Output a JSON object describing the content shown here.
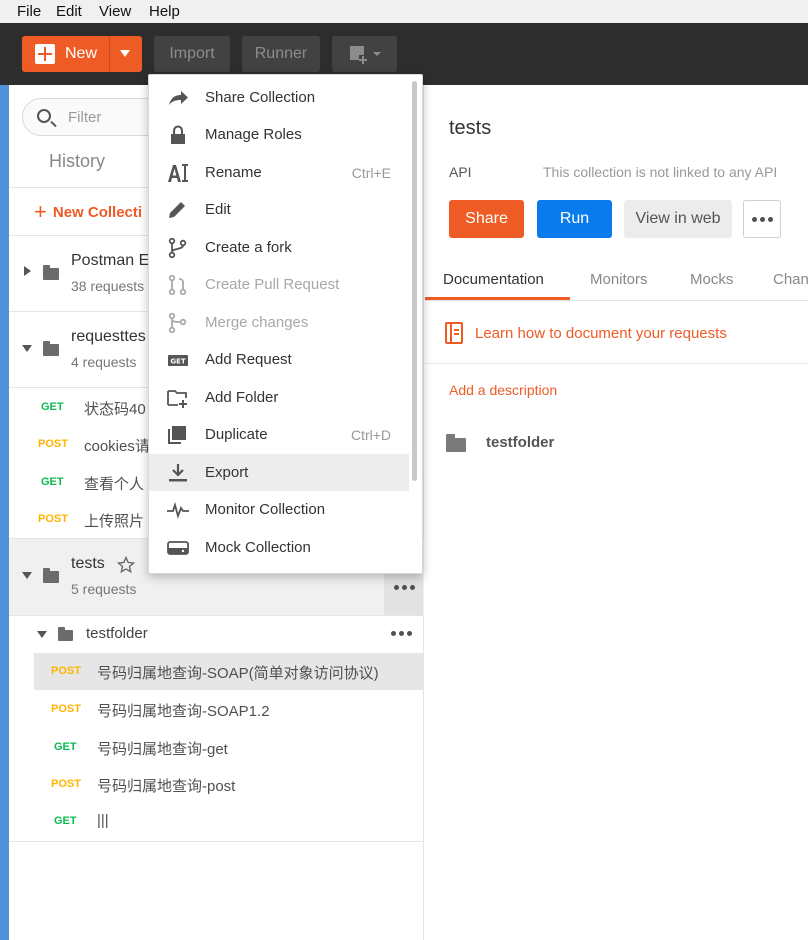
{
  "menubar": {
    "items": [
      "File",
      "Edit",
      "View",
      "Help"
    ]
  },
  "toolbar": {
    "new_label": "New",
    "import_label": "Import",
    "runner_label": "Runner"
  },
  "sidebar": {
    "search_placeholder": "Filter",
    "history_tab": "History",
    "new_collection": "New Collecti",
    "collections": [
      {
        "name": "Postman E",
        "count": "38 requests"
      },
      {
        "name": "requesttes",
        "count": "4 requests",
        "requests": [
          {
            "method": "GET",
            "name": "状态码40"
          },
          {
            "method": "POST",
            "name": "cookies请"
          },
          {
            "method": "GET",
            "name": "查看个人"
          },
          {
            "method": "POST",
            "name": "上传照片"
          }
        ]
      },
      {
        "name": "tests",
        "count": "5 requests",
        "folder": "testfolder",
        "requests": [
          {
            "method": "POST",
            "name": "号码归属地查询-SOAP(简单对象访问协议)"
          },
          {
            "method": "POST",
            "name": "号码归属地查询-SOAP1.2"
          },
          {
            "method": "GET",
            "name": "号码归属地查询-get"
          },
          {
            "method": "POST",
            "name": "号码归属地查询-post"
          },
          {
            "method": "GET",
            "name": "|||"
          }
        ]
      }
    ]
  },
  "main": {
    "title": "tests",
    "api_label": "API",
    "api_note": "This collection is not linked to any API",
    "share": "Share",
    "run": "Run",
    "view_in_web": "View in web",
    "tabs": [
      "Documentation",
      "Monitors",
      "Mocks",
      "Chan"
    ],
    "learn_link": "Learn how to document your requests",
    "add_description": "Add a description",
    "folder_name": "testfolder"
  },
  "dropdown": {
    "items": [
      {
        "label": "Share Collection",
        "shortcut": "",
        "icon": "share-arrow-icon"
      },
      {
        "label": "Manage Roles",
        "shortcut": "",
        "icon": "lock-icon"
      },
      {
        "label": "Rename",
        "shortcut": "Ctrl+E",
        "icon": "rename-cursor-icon"
      },
      {
        "label": "Edit",
        "shortcut": "",
        "icon": "pencil-icon"
      },
      {
        "label": "Create a fork",
        "shortcut": "",
        "icon": "fork-icon"
      },
      {
        "label": "Create Pull Request",
        "shortcut": "",
        "icon": "pull-request-icon"
      },
      {
        "label": "Merge changes",
        "shortcut": "",
        "icon": "merge-icon"
      },
      {
        "label": "Add Request",
        "shortcut": "",
        "icon": "get-request-icon",
        "badge": "GET"
      },
      {
        "label": "Add Folder",
        "shortcut": "",
        "icon": "add-folder-icon"
      },
      {
        "label": "Duplicate",
        "shortcut": "Ctrl+D",
        "icon": "duplicate-icon"
      },
      {
        "label": "Export",
        "shortcut": "",
        "icon": "download-icon"
      },
      {
        "label": "Monitor Collection",
        "shortcut": "",
        "icon": "pulse-icon"
      },
      {
        "label": "Mock Collection",
        "shortcut": "",
        "icon": "server-icon"
      }
    ]
  }
}
